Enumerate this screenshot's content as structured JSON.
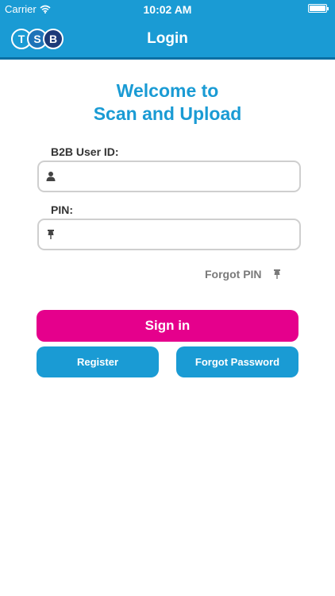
{
  "status_bar": {
    "carrier": "Carrier",
    "time": "10:02 AM"
  },
  "brand": {
    "letters": [
      "T",
      "S",
      "B"
    ]
  },
  "nav": {
    "title": "Login"
  },
  "welcome": {
    "line1": "Welcome to",
    "line2": "Scan and Upload"
  },
  "form": {
    "user_id_label": "B2B User ID:",
    "user_id_value": "",
    "user_id_icon": "person-icon",
    "pin_label": "PIN:",
    "pin_value": "",
    "pin_icon": "pushpin-icon",
    "forgot_pin": "Forgot PIN"
  },
  "buttons": {
    "sign_in": "Sign in",
    "register": "Register",
    "forgot_password": "Forgot Password"
  },
  "colors": {
    "header": "#1a9bd4",
    "accent_pink": "#e5008c",
    "title_blue": "#1a9bd4"
  }
}
